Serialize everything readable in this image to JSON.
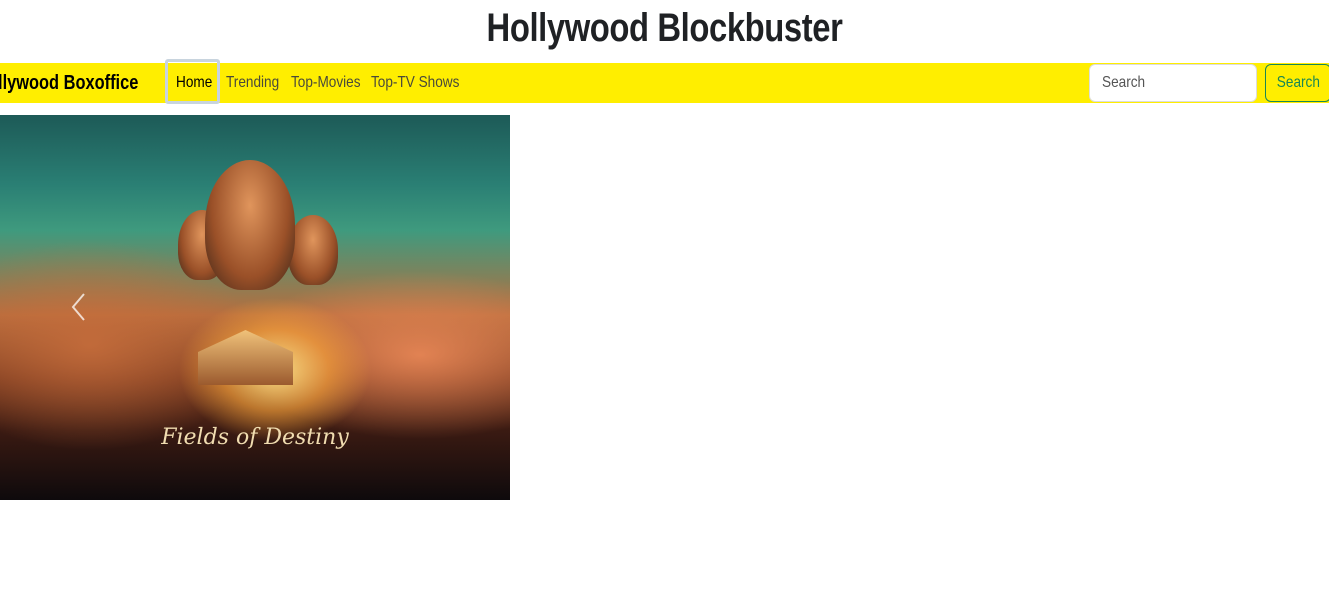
{
  "header": {
    "title": "Hollywood Blockbuster"
  },
  "navbar": {
    "brand": "ollywood Boxoffice",
    "links": [
      {
        "label": "Home",
        "active": true
      },
      {
        "label": "Trending",
        "active": false
      },
      {
        "label": "Top-Movies",
        "active": false
      },
      {
        "label": "Top-TV Shows",
        "active": false
      }
    ],
    "search": {
      "placeholder": "Search",
      "button_label": "Search"
    },
    "colors": {
      "background": "#ffee00",
      "search_button": "#198754"
    }
  },
  "carousel": {
    "poster_title": "Fields of Destiny",
    "prev_icon": "chevron-left-icon"
  }
}
